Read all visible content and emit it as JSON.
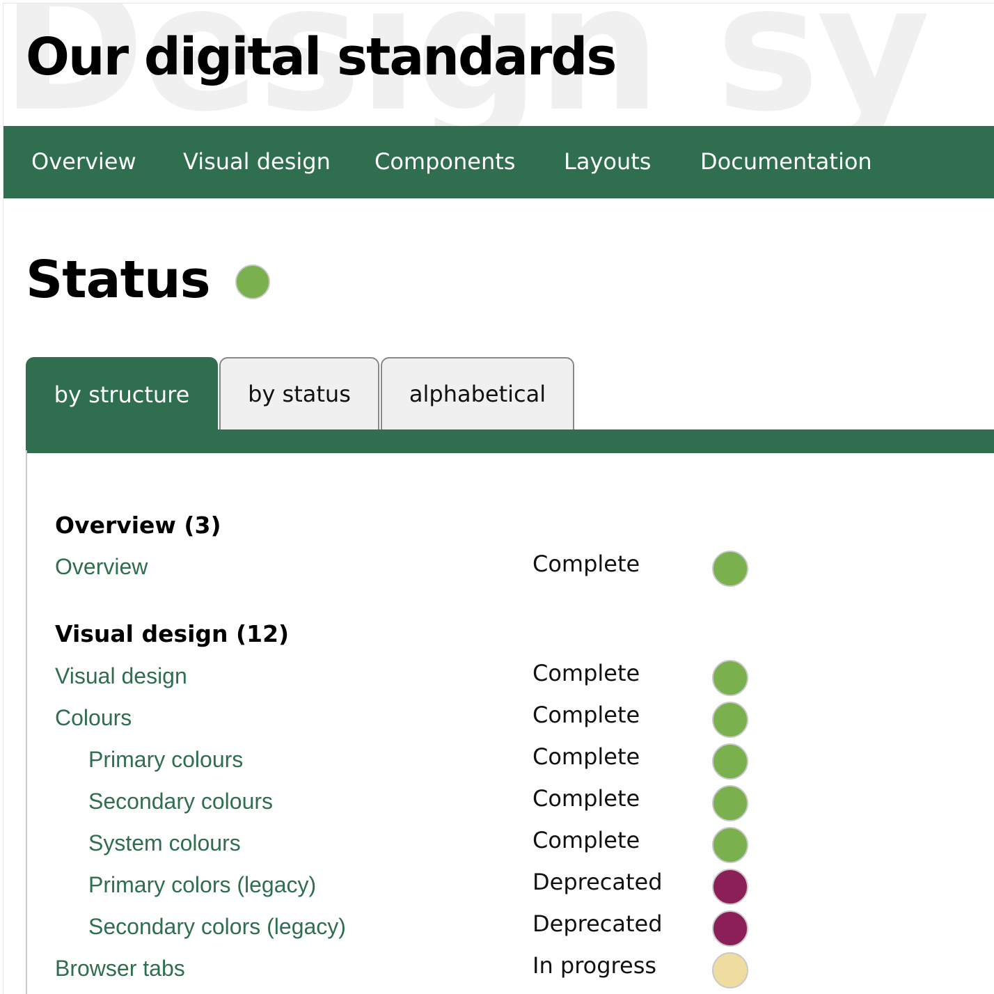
{
  "header": {
    "watermark": "Design sy",
    "site_title": "Our digital standards"
  },
  "nav": {
    "items": [
      {
        "label": "Overview"
      },
      {
        "label": "Visual design"
      },
      {
        "label": "Components"
      },
      {
        "label": "Layouts"
      },
      {
        "label": "Documentation"
      }
    ]
  },
  "page": {
    "title": "Status",
    "status_color": "#7ab04d"
  },
  "tabs": [
    {
      "label": "by structure",
      "active": true
    },
    {
      "label": "by status",
      "active": false
    },
    {
      "label": "alphabetical",
      "active": false
    }
  ],
  "colors": {
    "brand_green": "#2f6e4f",
    "complete": "#7ab04d",
    "deprecated": "#8b1f57",
    "in_progress": "#efdca0"
  },
  "groups": [
    {
      "title": "Overview (3)",
      "items": [
        {
          "label": "Overview",
          "status": "Complete",
          "color": "#7ab04d",
          "indent": false
        }
      ]
    },
    {
      "title": "Visual design (12)",
      "items": [
        {
          "label": "Visual design",
          "status": "Complete",
          "color": "#7ab04d",
          "indent": false
        },
        {
          "label": "Colours",
          "status": "Complete",
          "color": "#7ab04d",
          "indent": false
        },
        {
          "label": "Primary colours",
          "status": "Complete",
          "color": "#7ab04d",
          "indent": true
        },
        {
          "label": "Secondary colours",
          "status": "Complete",
          "color": "#7ab04d",
          "indent": true
        },
        {
          "label": "System colours",
          "status": "Complete",
          "color": "#7ab04d",
          "indent": true
        },
        {
          "label": "Primary colors (legacy)",
          "status": "Deprecated",
          "color": "#8b1f57",
          "indent": true
        },
        {
          "label": "Secondary colors (legacy)",
          "status": "Deprecated",
          "color": "#8b1f57",
          "indent": true
        },
        {
          "label": "Browser tabs",
          "status": "In progress",
          "color": "#efdca0",
          "indent": false
        }
      ]
    }
  ]
}
